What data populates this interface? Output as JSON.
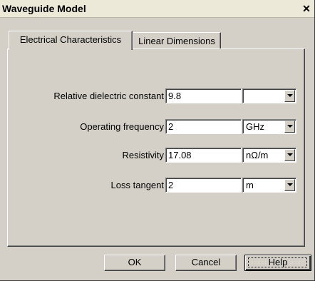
{
  "window": {
    "title": "Waveguide Model",
    "close_glyph": "✕"
  },
  "tabs": [
    {
      "label": "Electrical Characteristics",
      "active": true
    },
    {
      "label": "Linear Dimensions",
      "active": false
    }
  ],
  "fields": [
    {
      "label": "Relative dielectric constant",
      "value": "9.8",
      "unit": ""
    },
    {
      "label": "Operating frequency",
      "value": "2",
      "unit": "GHz"
    },
    {
      "label": "Resistivity",
      "value": "17.08",
      "unit": "nΩ/m"
    },
    {
      "label": "Loss tangent",
      "value": "2",
      "unit": "m"
    }
  ],
  "buttons": {
    "ok": "OK",
    "cancel": "Cancel",
    "help": "Help"
  },
  "colors": {
    "face": "#d4d0c8",
    "titlebar": "#ece9d8"
  }
}
